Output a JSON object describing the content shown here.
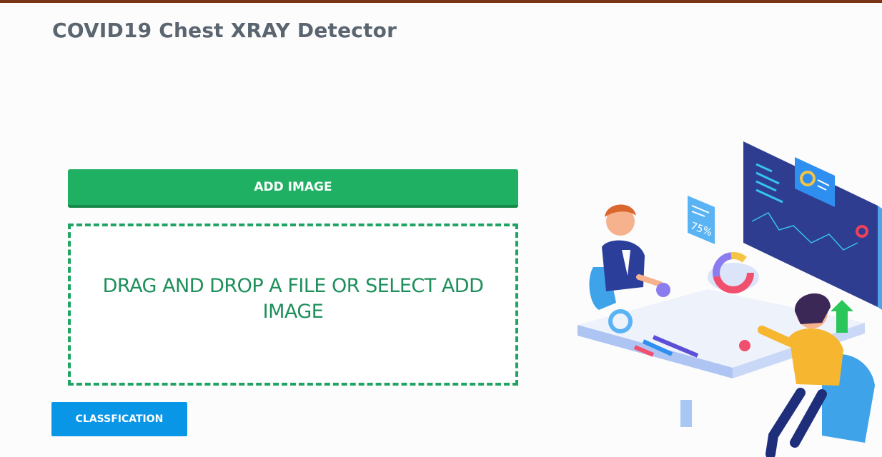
{
  "header": {
    "title": "COVID19 Chest XRAY Detector"
  },
  "upload": {
    "add_image_label": "ADD IMAGE",
    "dropzone_text": "DRAG AND DROP A FILE OR SELECT ADD IMAGE"
  },
  "actions": {
    "classification_label": "CLASSFICATION"
  },
  "illustration": {
    "badge_percent": "75%",
    "icon": "business-meeting-illustration"
  },
  "colors": {
    "top_bar": "#7a3416",
    "title": "#5a6570",
    "add_button": "#20b063",
    "dropzone_border": "#1fa464",
    "dropzone_text": "#1e8f5a",
    "classify_button": "#0996e6"
  }
}
